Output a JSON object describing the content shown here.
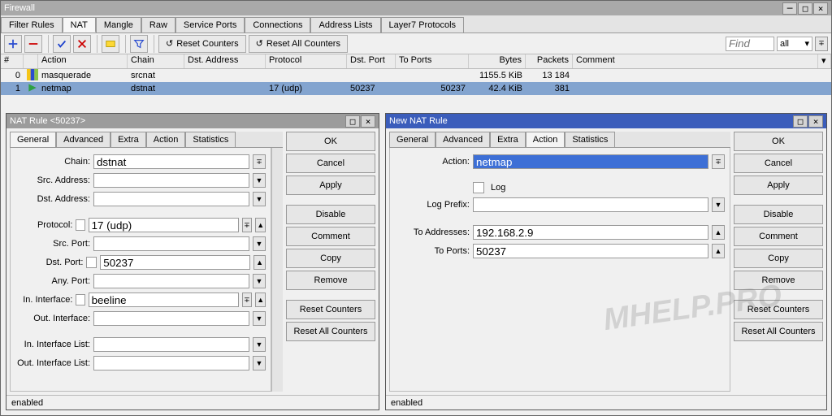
{
  "window": {
    "title": "Firewall"
  },
  "tabs": [
    "Filter Rules",
    "NAT",
    "Mangle",
    "Raw",
    "Service Ports",
    "Connections",
    "Address Lists",
    "Layer7 Protocols"
  ],
  "active_tab": "NAT",
  "toolbar": {
    "reset_counters": "Reset Counters",
    "reset_all_counters": "Reset All Counters",
    "find_placeholder": "Find",
    "filter_all": "all"
  },
  "grid": {
    "columns": [
      "#",
      "",
      "Action",
      "Chain",
      "Dst. Address",
      "Protocol",
      "Dst. Port",
      "To Ports",
      "Bytes",
      "Packets",
      "Comment"
    ],
    "rows": [
      {
        "n": "0",
        "action": "masquerade",
        "chain": "srcnat",
        "dstaddr": "",
        "protocol": "",
        "dstport": "",
        "toports": "",
        "bytes": "1155.5 KiB",
        "packets": "13 184",
        "comment": ""
      },
      {
        "n": "1",
        "action": "netmap",
        "chain": "dstnat",
        "dstaddr": "",
        "protocol": "17 (udp)",
        "dstport": "50237",
        "toports": "50237",
        "bytes": "42.4 KiB",
        "packets": "381",
        "comment": ""
      }
    ],
    "selected": 1
  },
  "dialog_left": {
    "title": "NAT Rule <50237>",
    "tabs": [
      "General",
      "Advanced",
      "Extra",
      "Action",
      "Statistics"
    ],
    "active": "General",
    "fields": {
      "chain_label": "Chain:",
      "chain": "dstnat",
      "src_addr_label": "Src. Address:",
      "src_addr": "",
      "dst_addr_label": "Dst. Address:",
      "dst_addr": "",
      "protocol_label": "Protocol:",
      "protocol": "17 (udp)",
      "src_port_label": "Src. Port:",
      "src_port": "",
      "dst_port_label": "Dst. Port:",
      "dst_port": "50237",
      "any_port_label": "Any. Port:",
      "any_port": "",
      "in_if_label": "In. Interface:",
      "in_if": "beeline",
      "out_if_label": "Out. Interface:",
      "out_if": "",
      "in_if_list_label": "In. Interface List:",
      "in_if_list": "",
      "out_if_list_label": "Out. Interface List:",
      "out_if_list": ""
    },
    "status": "enabled"
  },
  "dialog_right": {
    "title": "New NAT Rule",
    "tabs": [
      "General",
      "Advanced",
      "Extra",
      "Action",
      "Statistics"
    ],
    "active": "Action",
    "fields": {
      "action_label": "Action:",
      "action": "netmap",
      "log_label": "Log",
      "log_prefix_label": "Log Prefix:",
      "log_prefix": "",
      "to_addr_label": "To Addresses:",
      "to_addr": "192.168.2.9",
      "to_ports_label": "To Ports:",
      "to_ports": "50237"
    },
    "status": "enabled"
  },
  "buttons": {
    "ok": "OK",
    "cancel": "Cancel",
    "apply": "Apply",
    "disable": "Disable",
    "comment": "Comment",
    "copy": "Copy",
    "remove": "Remove",
    "reset_counters": "Reset Counters",
    "reset_all_counters": "Reset All Counters"
  },
  "watermark": "MHELP.PRO"
}
